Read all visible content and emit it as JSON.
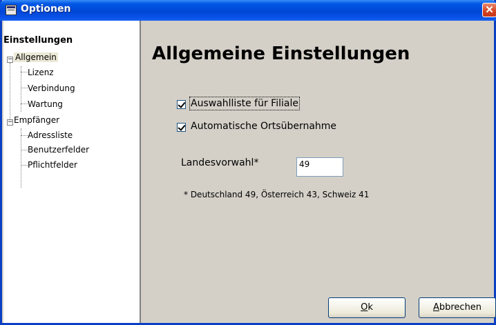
{
  "window": {
    "title": "Optionen"
  },
  "tree": {
    "root": "Einstellungen",
    "groups": [
      {
        "label": "Allgemein",
        "expander": "−",
        "children": [
          "Lizenz",
          "Verbindung",
          "Wartung"
        ]
      },
      {
        "label": "Empfänger",
        "expander": "−",
        "children": [
          "Adressliste",
          "Benutzerfelder",
          "Pflichtfelder"
        ]
      }
    ]
  },
  "main": {
    "heading": "Allgemeine Einstellungen",
    "checkboxes": [
      {
        "label": "Auswahlliste für Filiale",
        "checked": true
      },
      {
        "label": "Automatische Ortsübernahme",
        "checked": true
      }
    ],
    "landesvorwahl": {
      "label": "Landesvorwahl*",
      "value": "49"
    },
    "note": "* Deutschland 49, Österreich 43, Schweiz 41"
  },
  "buttons": {
    "ok_mnemonic": "O",
    "ok_rest": "k",
    "cancel_mnemonic": "A",
    "cancel_rest": "bbrechen"
  },
  "colors": {
    "titlebar": "#0046d6",
    "face": "#d4d0c8",
    "close": "#d6421e"
  }
}
